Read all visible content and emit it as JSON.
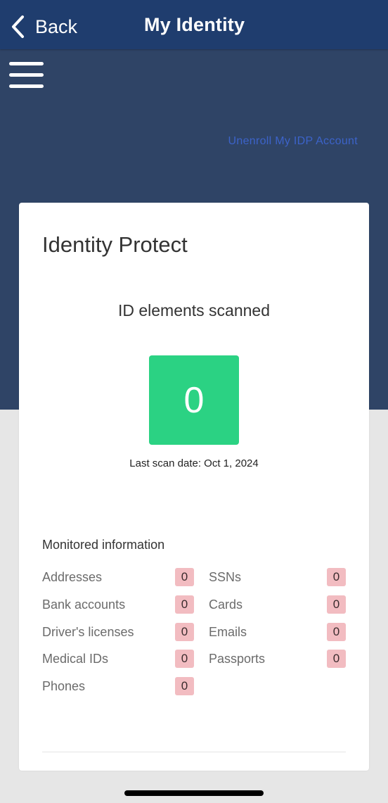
{
  "navbar": {
    "back_label": "Back",
    "back_icon": "chevron-left-icon",
    "title": "My Identity"
  },
  "hero": {
    "menu_icon": "hamburger-menu-icon",
    "unenroll_link": "Unenroll My IDP Account"
  },
  "card": {
    "title": "Identity Protect",
    "scanned_label": "ID elements scanned",
    "scanned_count": "0",
    "last_scan": "Last scan date: Oct 1, 2024",
    "monitored": {
      "title": "Monitored information",
      "left": [
        {
          "label": "Addresses",
          "count": "0"
        },
        {
          "label": "Bank accounts",
          "count": "0"
        },
        {
          "label": "Driver's licenses",
          "count": "0"
        },
        {
          "label": "Medical IDs",
          "count": "0"
        },
        {
          "label": "Phones",
          "count": "0"
        }
      ],
      "right": [
        {
          "label": "SSNs",
          "count": "0"
        },
        {
          "label": "Cards",
          "count": "0"
        },
        {
          "label": "Emails",
          "count": "0"
        },
        {
          "label": "Passports",
          "count": "0"
        }
      ]
    }
  },
  "colors": {
    "navbar": "#1f3d6e",
    "hero": "#2f4466",
    "link": "#3c63c9",
    "count_box": "#2bd283",
    "badge": "#f2bcc1",
    "page_bg": "#e6e6e6"
  }
}
